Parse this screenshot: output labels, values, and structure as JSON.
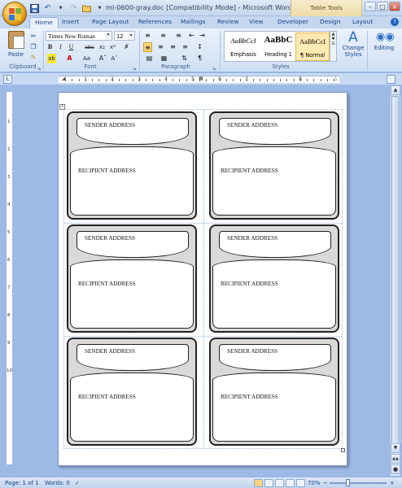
{
  "window": {
    "title": "ml-0600-gray.doc [Compatibility Mode] - Microsoft Word",
    "contextual_tab_group": "Table Tools"
  },
  "tabs": [
    "Home",
    "Insert",
    "Page Layout",
    "References",
    "Mailings",
    "Review",
    "View",
    "Developer",
    "Design",
    "Layout"
  ],
  "active_tab": "Home",
  "ribbon": {
    "clipboard": {
      "paste_label": "Paste",
      "group_label": "Clipboard"
    },
    "font": {
      "font_name": "Times New Roman",
      "font_size": "12",
      "group_label": "Font"
    },
    "paragraph": {
      "group_label": "Paragraph"
    },
    "styles": {
      "group_label": "Styles",
      "items": [
        {
          "preview": "AaBbCcI",
          "name": "Emphasis"
        },
        {
          "preview": "AaBbC",
          "name": "Heading 1"
        },
        {
          "preview": "AaBbCcI",
          "name": "¶ Normal"
        }
      ],
      "change_styles_label": "Change Styles",
      "editing_label": "Editing"
    }
  },
  "ruler": {
    "labels": [
      "1",
      "2",
      "3",
      "4",
      "5",
      "6",
      "7",
      "8"
    ]
  },
  "vertical_ruler": {
    "labels": [
      "1",
      "2",
      "3",
      "4",
      "5",
      "6",
      "7",
      "8",
      "9",
      "10"
    ]
  },
  "document": {
    "cards": [
      {
        "sender": "SENDER ADDRESS",
        "recipient": "RECIPIENT ADDRESS"
      },
      {
        "sender": "SENDER ADDRESS",
        "recipient": "RECIPIENT ADDRESS"
      },
      {
        "sender": "SENDER ADDRESS",
        "recipient": "RECIPIENT ADDRESS"
      },
      {
        "sender": "SENDER ADDRESS",
        "recipient": "RECIPIENT ADDRESS"
      },
      {
        "sender": "SENDER ADDRESS",
        "recipient": "RECIPIENT ADDRESS"
      },
      {
        "sender": "SENDER ADDRESS",
        "recipient": "RECIPIENT ADDRESS"
      }
    ]
  },
  "status": {
    "page": "Page: 1 of 1",
    "words": "Words: 0",
    "zoom": "70%",
    "zoom_level": 0.7
  },
  "colors": {
    "ribbon_blue": "#dce8f7",
    "text_blue": "#15428b",
    "card_gray": "#d9d9d9"
  }
}
